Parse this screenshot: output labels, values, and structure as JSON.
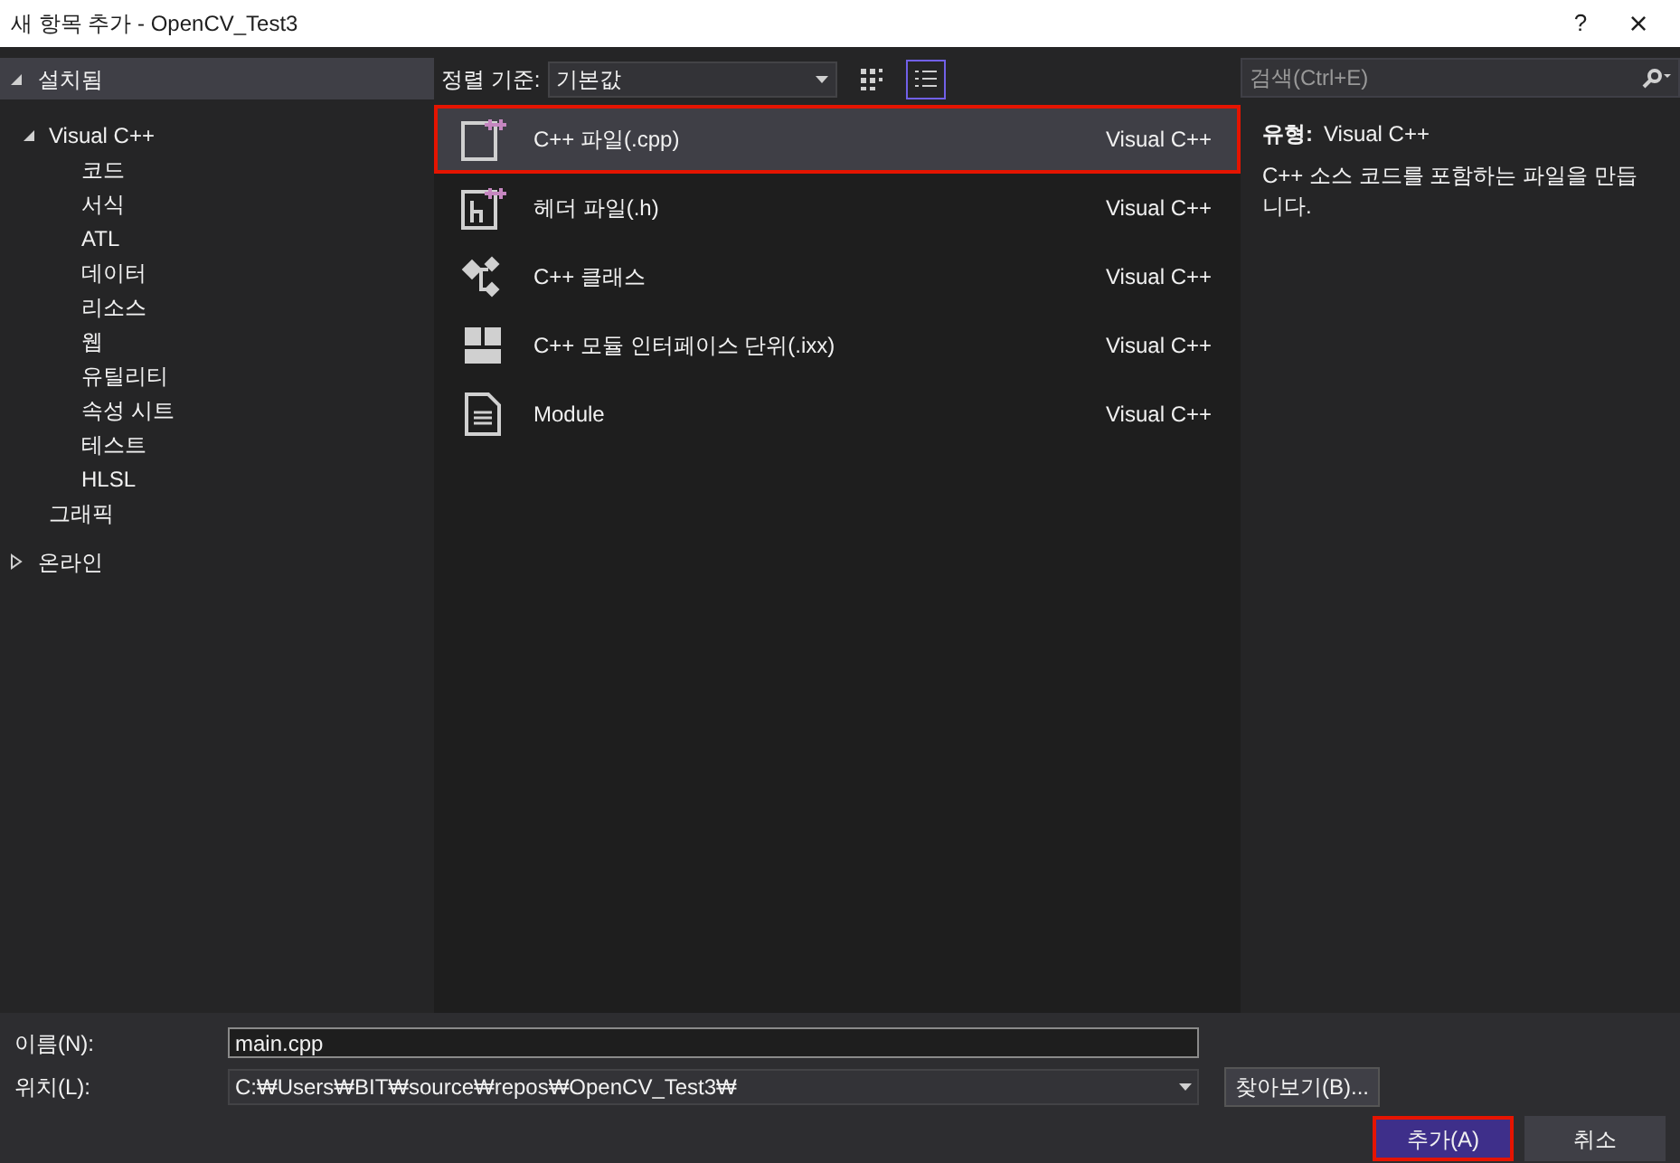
{
  "window": {
    "title": "새 항목 추가 - OpenCV_Test3",
    "help": "?",
    "close": "×"
  },
  "sidebar": {
    "items": [
      {
        "label": "설치됨",
        "expanded": true,
        "header": true,
        "children": [
          {
            "label": "Visual C++",
            "expanded": true,
            "children": [
              {
                "label": "코드"
              },
              {
                "label": "서식"
              },
              {
                "label": "ATL"
              },
              {
                "label": "데이터"
              },
              {
                "label": "리소스"
              },
              {
                "label": "웹"
              },
              {
                "label": "유틸리티"
              },
              {
                "label": "속성 시트"
              },
              {
                "label": "테스트"
              },
              {
                "label": "HLSL"
              }
            ]
          },
          {
            "label": "그래픽"
          }
        ]
      },
      {
        "label": "온라인",
        "expanded": false,
        "header": false
      }
    ]
  },
  "toolbar": {
    "sort_label": "정렬 기준:",
    "sort_value": "기본값",
    "views": [
      {
        "kind": "grid",
        "selected": false
      },
      {
        "kind": "list",
        "selected": true
      }
    ]
  },
  "templates": [
    {
      "kind": "cpp",
      "name": "C++ 파일(.cpp)",
      "language": "Visual C++",
      "selected": true
    },
    {
      "kind": "header",
      "name": "헤더 파일(.h)",
      "language": "Visual C++",
      "selected": false
    },
    {
      "kind": "class",
      "name": "C++ 클래스",
      "language": "Visual C++",
      "selected": false
    },
    {
      "kind": "interface",
      "name": "C++ 모듈 인터페이스 단위(.ixx)",
      "language": "Visual C++",
      "selected": false
    },
    {
      "kind": "module",
      "name": "Module",
      "language": "Visual C++",
      "selected": false
    }
  ],
  "search": {
    "placeholder": "검색(Ctrl+E)"
  },
  "details": {
    "type_label": "유형:",
    "type_value": "Visual C++",
    "description": "C++ 소스 코드를 포함하는 파일을 만듭니다."
  },
  "form": {
    "name_label": "이름(N):",
    "name_value": "main.cpp",
    "location_label": "위치(L):",
    "location_value": "C:₩Users₩BIT₩source₩repos₩OpenCV_Test3₩",
    "browse": "찾아보기(B)..."
  },
  "buttons": [
    {
      "label": "추가(A)",
      "primary": true
    },
    {
      "label": "취소",
      "primary": false
    }
  ]
}
